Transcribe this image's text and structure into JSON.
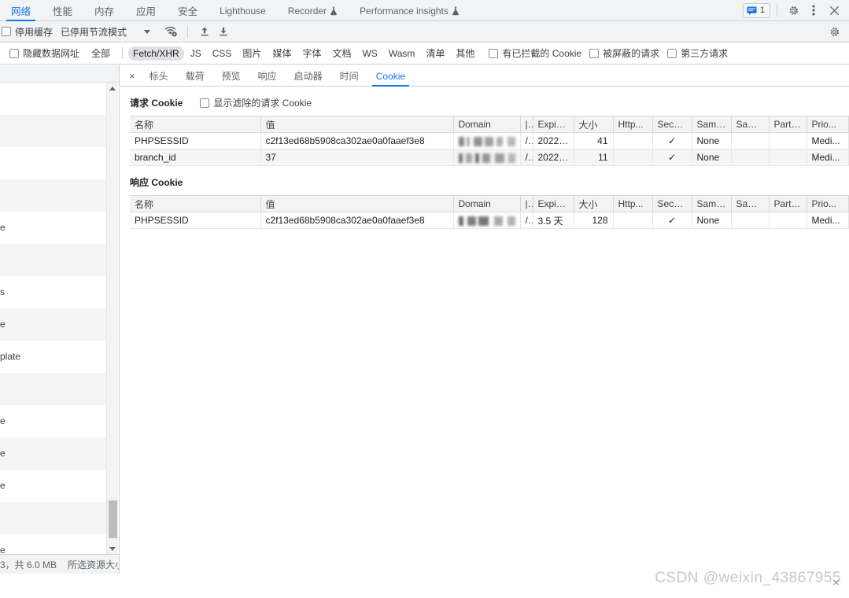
{
  "devtools_tabs": {
    "items": [
      {
        "label": "网络",
        "active": true,
        "experimental": false
      },
      {
        "label": "性能",
        "active": false,
        "experimental": false
      },
      {
        "label": "内存",
        "active": false,
        "experimental": false
      },
      {
        "label": "应用",
        "active": false,
        "experimental": false
      },
      {
        "label": "安全",
        "active": false,
        "experimental": false
      },
      {
        "label": "Lighthouse",
        "active": false,
        "experimental": false
      },
      {
        "label": "Recorder",
        "active": false,
        "experimental": true
      },
      {
        "label": "Performance insights",
        "active": false,
        "experimental": true
      }
    ],
    "right_controls": {
      "message_count": "1",
      "settings_label": "设置",
      "more_label": "更多选项",
      "close_label": "关闭"
    }
  },
  "network_toolbar": {
    "disable_cache_label": "停用缓存",
    "disable_cache_checked": false,
    "throttling_label": "已停用节流模式",
    "throttling_caret": "▼",
    "wifi_settings_icon": "network-conditions-icon",
    "import_har_icon": "upload-icon",
    "export_har_icon": "download-icon",
    "settings_icon": "gear-icon"
  },
  "filter_bar": {
    "hide_data_urls_label": "隐藏数据网址",
    "hide_data_urls_checked": false,
    "types": [
      {
        "label": "全部",
        "selected": false
      },
      {
        "label": "Fetch/XHR",
        "selected": true
      },
      {
        "label": "JS",
        "selected": false
      },
      {
        "label": "CSS",
        "selected": false
      },
      {
        "label": "图片",
        "selected": false
      },
      {
        "label": "媒体",
        "selected": false
      },
      {
        "label": "字体",
        "selected": false
      },
      {
        "label": "文档",
        "selected": false
      },
      {
        "label": "WS",
        "selected": false
      },
      {
        "label": "Wasm",
        "selected": false
      },
      {
        "label": "清单",
        "selected": false
      },
      {
        "label": "其他",
        "selected": false
      }
    ],
    "checkboxes": [
      {
        "label": "有已拦截的 Cookie",
        "checked": false
      },
      {
        "label": "被屏蔽的请求",
        "checked": false
      },
      {
        "label": "第三方请求",
        "checked": false
      }
    ]
  },
  "request_list": {
    "rows": [
      {
        "text": ""
      },
      {
        "text": ""
      },
      {
        "text": ""
      },
      {
        "text": ""
      },
      {
        "text": "e"
      },
      {
        "text": ""
      },
      {
        "text": "s"
      },
      {
        "text": "e"
      },
      {
        "text": "plate"
      },
      {
        "text": ""
      },
      {
        "text": "e"
      },
      {
        "text": "e"
      },
      {
        "text": "e"
      },
      {
        "text": ""
      },
      {
        "text": "e"
      }
    ],
    "scrollbar": "vertical-scrollbar"
  },
  "status_bar": {
    "transferred": "3，共 6.0 MB",
    "resources": "所选资源大小"
  },
  "detail_tabs": {
    "close_label": "×",
    "items": [
      {
        "label": "标头",
        "active": false
      },
      {
        "label": "载荷",
        "active": false
      },
      {
        "label": "预览",
        "active": false
      },
      {
        "label": "响应",
        "active": false
      },
      {
        "label": "启动器",
        "active": false
      },
      {
        "label": "时间",
        "active": false
      },
      {
        "label": "Cookie",
        "active": true
      }
    ]
  },
  "request_cookies": {
    "title": "请求 Cookie",
    "show_filtered_label": "显示滤除的请求 Cookie",
    "show_filtered_checked": false,
    "columns": [
      "名称",
      "值",
      "Domain",
      "|",
      "Expire..",
      "大小",
      "Http...",
      "Secure",
      "Same...",
      "Same..",
      "Partiti..",
      "Prio..."
    ],
    "rows": [
      {
        "name": "PHPSESSID",
        "value": "c2f13ed68b5908ca302ae0a0faaef3e8",
        "domain": "",
        "path": "/",
        "expires": "2022-...",
        "size": "41",
        "http_only": "",
        "secure": "✓",
        "same_site": "None",
        "same_party": "",
        "partition_key": "",
        "priority": "Medi..."
      },
      {
        "name": "branch_id",
        "value": "37",
        "domain": "",
        "path": "/",
        "expires": "2022-...",
        "size": "11",
        "http_only": "",
        "secure": "✓",
        "same_site": "None",
        "same_party": "",
        "partition_key": "",
        "priority": "Medi..."
      }
    ]
  },
  "response_cookies": {
    "title": "响应 Cookie",
    "columns": [
      "名称",
      "值",
      "Domain",
      "|",
      "Expire..",
      "大小",
      "Http...",
      "Secure",
      "Same...",
      "Same..",
      "Partiti..",
      "Prio..."
    ],
    "rows": [
      {
        "name": "PHPSESSID",
        "value": "c2f13ed68b5908ca302ae0a0faaef3e8",
        "domain": "",
        "path": "/",
        "expires": "3.5 天",
        "size": "128",
        "http_only": "",
        "secure": "✓",
        "same_site": "None",
        "same_party": "",
        "partition_key": "",
        "priority": "Medi..."
      }
    ]
  },
  "watermark": {
    "text": "CSDN @weixin_43867955"
  },
  "colors": {
    "accent": "#1a73e8",
    "toolbar_bg": "#f1f3f4",
    "border": "#cdd0d3",
    "text": "#202124",
    "muted": "#5f6368",
    "row_alt": "#f5f5f5"
  }
}
